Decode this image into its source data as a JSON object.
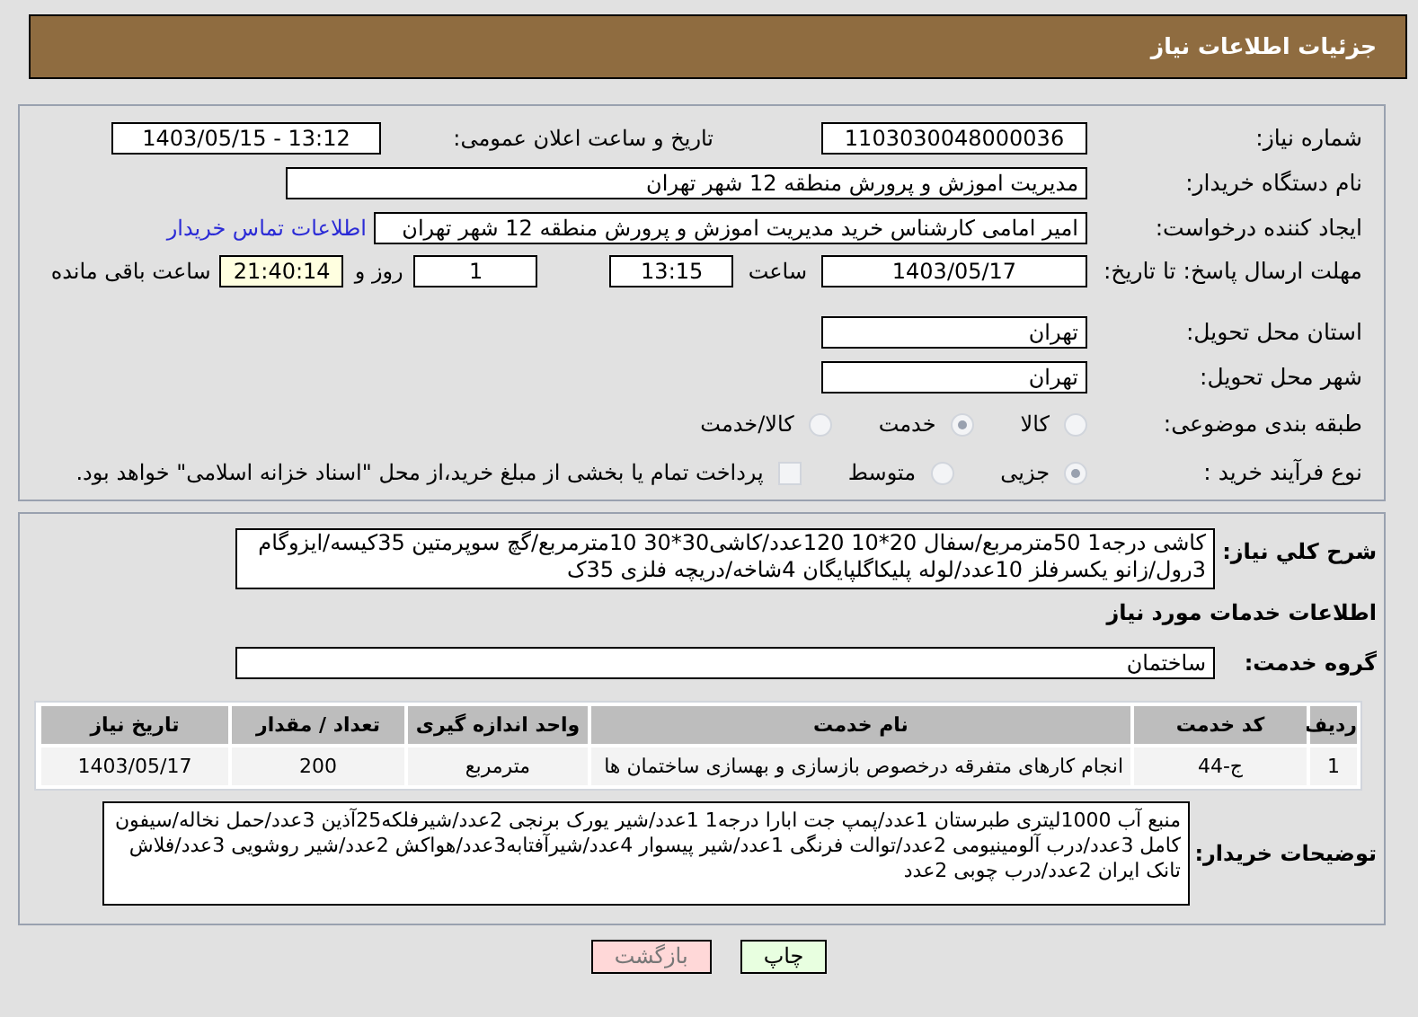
{
  "header": {
    "title": "جزئیات اطلاعات نیاز"
  },
  "need_number": {
    "label": "شماره نیاز:",
    "value": "1103030048000036"
  },
  "announce": {
    "label": "تاریخ و ساعت اعلان عمومی:",
    "value": "1403/05/15 - 13:12"
  },
  "buyer_org": {
    "label": "نام دستگاه خریدار:",
    "value": "مدیریت اموزش و پرورش منطقه 12 شهر تهران"
  },
  "creator": {
    "label": "ایجاد کننده درخواست:",
    "value": "امیر امامی کارشناس خرید مدیریت اموزش و پرورش منطقه 12 شهر تهران",
    "link": "اطلاعات تماس خریدار"
  },
  "deadline": {
    "label": "مهلت ارسال پاسخ: تا تاریخ:",
    "date": "1403/05/17",
    "time_label": "ساعت",
    "time": "13:15",
    "days": "1",
    "days_label": "روز و",
    "remaining": "21:40:14",
    "remaining_label": "ساعت باقی مانده"
  },
  "province": {
    "label": "استان محل تحویل:",
    "value": "تهران"
  },
  "city": {
    "label": "شهر محل تحویل:",
    "value": "تهران"
  },
  "category": {
    "label": "طبقه بندی موضوعی:",
    "options": [
      {
        "label": "کالا",
        "selected": false
      },
      {
        "label": "خدمت",
        "selected": true
      },
      {
        "label": "کالا/خدمت",
        "selected": false
      }
    ]
  },
  "process": {
    "label": "نوع فرآیند خرید :",
    "options": [
      {
        "label": "جزیی",
        "selected": true
      },
      {
        "label": "متوسط",
        "selected": false
      }
    ],
    "payment": {
      "label": "پرداخت تمام یا بخشی از مبلغ خرید،از محل \"اسناد خزانه اسلامی\" خواهد بود.",
      "checked": false
    }
  },
  "summary": {
    "label": "شرح کلي نياز:",
    "value": "کاشی درجه1 50مترمربع/سفال 20*10 120عدد/کاشی30*30 10مترمربع/گچ سوپرمتین 35کیسه/ایزوگام 3رول/زانو یکسرفلز 10عدد/لوله پلیکاگلپایگان 4شاخه/دریچه فلزی 35ک"
  },
  "services_title": "اطلاعات خدمات مورد نياز",
  "service_group": {
    "label": "گروه خدمت:",
    "value": "ساختمان"
  },
  "table": {
    "columns": [
      "ردیف",
      "کد خدمت",
      "نام خدمت",
      "واحد اندازه گیری",
      "تعداد / مقدار",
      "تاریخ نیاز"
    ],
    "rows": [
      [
        "1",
        "ج-44",
        "انجام کارهای متفرقه درخصوص بازسازی و بهسازی ساختمان ها",
        "مترمربع",
        "200",
        "1403/05/17"
      ]
    ]
  },
  "buyer_notes": {
    "label": "توضیحات خریدار:",
    "value": "منبع آب 1000لیتری طبرستان 1عدد/پمپ جت ابارا درجه1 1عدد/شیر یورک برنجی 2عدد/شیرفلکه25آذین 3عدد/حمل نخاله/سیفون کامل 3عدد/درب آلومینیومی 2عدد/توالت فرنگی 1عدد/شیر پیسوار 4عدد/شیرآفتابه3عدد/هواکش 2عدد/شیر روشویی 3عدد/فلاش تانک ایران 2عدد/درب چوبی 2عدد"
  },
  "buttons": [
    {
      "label": "چاپ",
      "kind": "print"
    },
    {
      "label": "بازگشت",
      "kind": "back"
    }
  ]
}
